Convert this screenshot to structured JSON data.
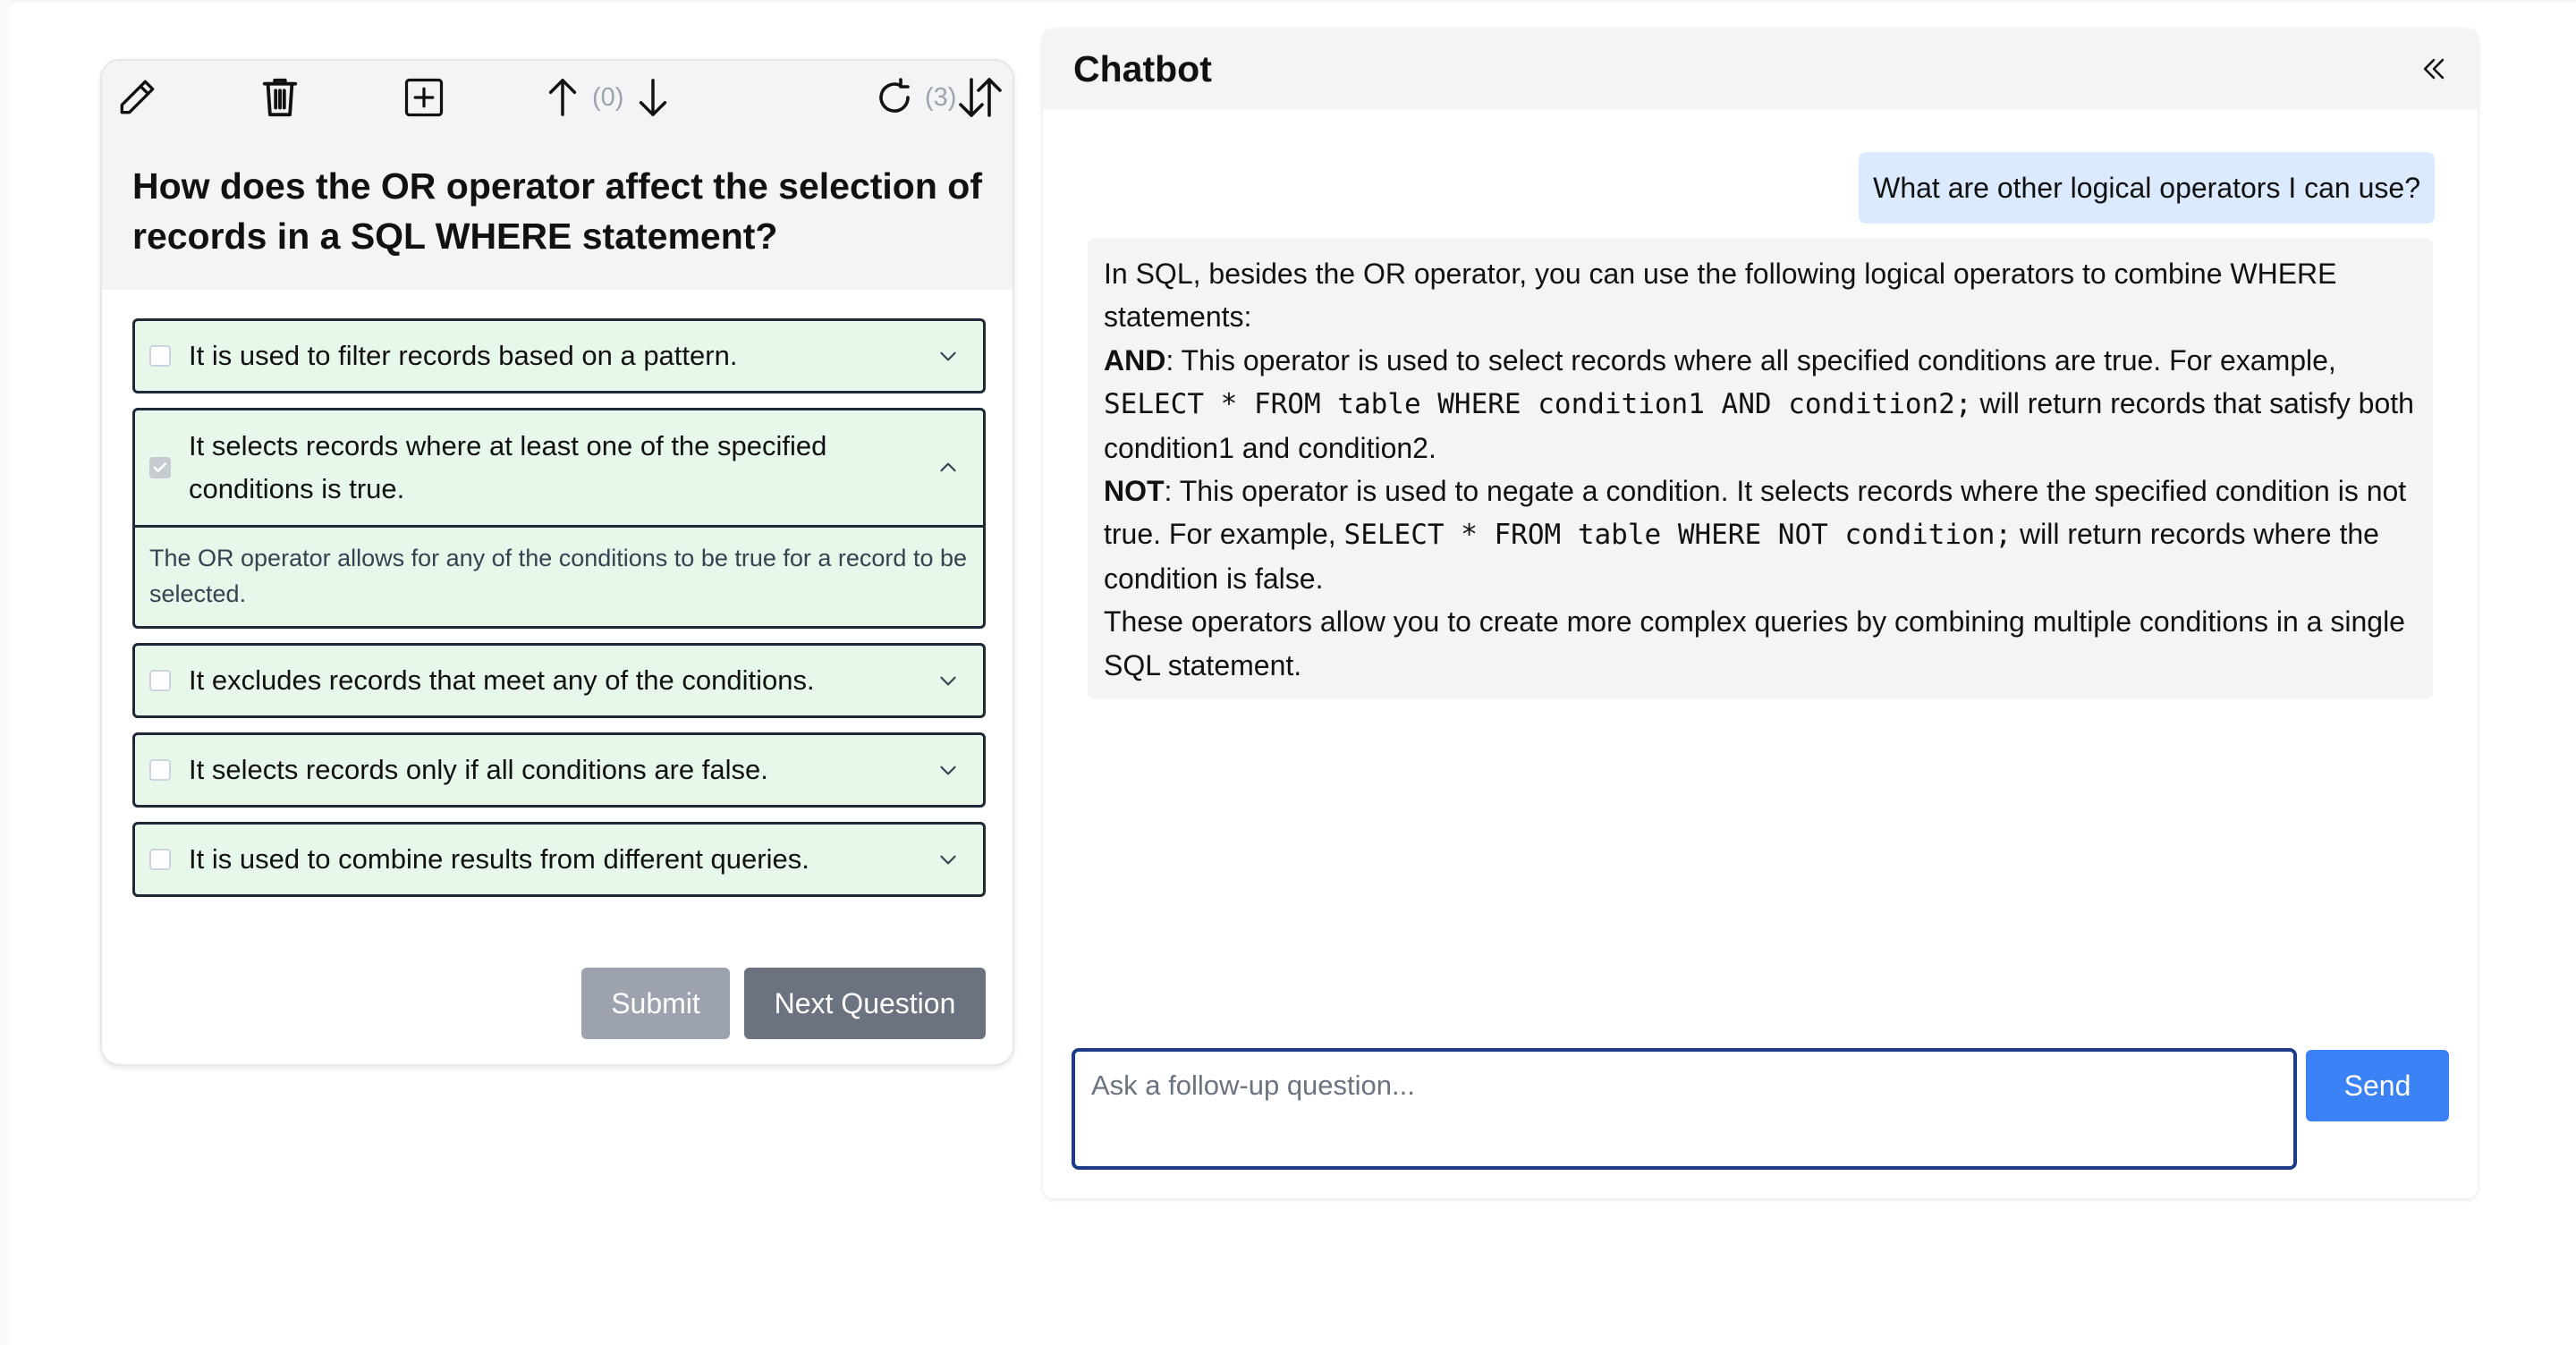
{
  "quiz": {
    "toolbar": {
      "edit_icon": "pencil-icon",
      "delete_icon": "trash-icon",
      "add_icon": "plus-square-icon",
      "move_up_icon": "arrow-up-icon",
      "position_count": "(0)",
      "move_down_icon": "arrow-down-icon",
      "regenerate_icon": "refresh-icon",
      "regenerate_count": "(3)",
      "shuffle_icon": "sort-arrows-icon"
    },
    "question": "How does the OR operator affect the selection of records in a SQL WHERE statement?",
    "options": [
      {
        "text": "It is used to filter records based on a pattern.",
        "checked": false,
        "expanded": false
      },
      {
        "text": "It selects records where at least one of the specified conditions is true.",
        "checked": true,
        "expanded": true,
        "explanation": "The OR operator allows for any of the conditions to be true for a record to be selected."
      },
      {
        "text": "It excludes records that meet any of the conditions.",
        "checked": false,
        "expanded": false
      },
      {
        "text": "It selects records only if all conditions are false.",
        "checked": false,
        "expanded": false
      },
      {
        "text": "It is used to combine results from different queries.",
        "checked": false,
        "expanded": false
      }
    ],
    "submit_label": "Submit",
    "next_label": "Next Question"
  },
  "chat": {
    "title": "Chatbot",
    "collapse_icon": "double-chevron-left-icon",
    "user_message": "What are other logical operators I can use?",
    "bot_message": {
      "intro": "In SQL, besides the OR operator, you can use the following logical operators to combine WHERE statements:",
      "and_term": "AND",
      "and_text_1": ": This operator is used to select records where all specified conditions are true. For example, ",
      "and_code": "SELECT * FROM table WHERE condition1 AND condition2;",
      "and_text_2": " will return records that satisfy both condition1 and condition2.",
      "not_term": "NOT",
      "not_text_1": ": This operator is used to negate a condition. It selects records where the specified condition is not true. For example, ",
      "not_code": "SELECT * FROM table WHERE NOT condition;",
      "not_text_2": " will return records where the condition is false.",
      "outro": "These operators allow you to create more complex queries by combining multiple conditions in a single SQL statement."
    },
    "input_placeholder": "Ask a follow-up question...",
    "input_value": "",
    "send_label": "Send"
  },
  "colors": {
    "option_bg": "#e7f8ea",
    "option_border": "#1f2937",
    "user_bubble": "#dbeafe",
    "send_button": "#3b82f6",
    "submit_disabled": "#9ca3af",
    "next_button": "#6b7280",
    "input_focus_border": "#1e3a8a"
  }
}
